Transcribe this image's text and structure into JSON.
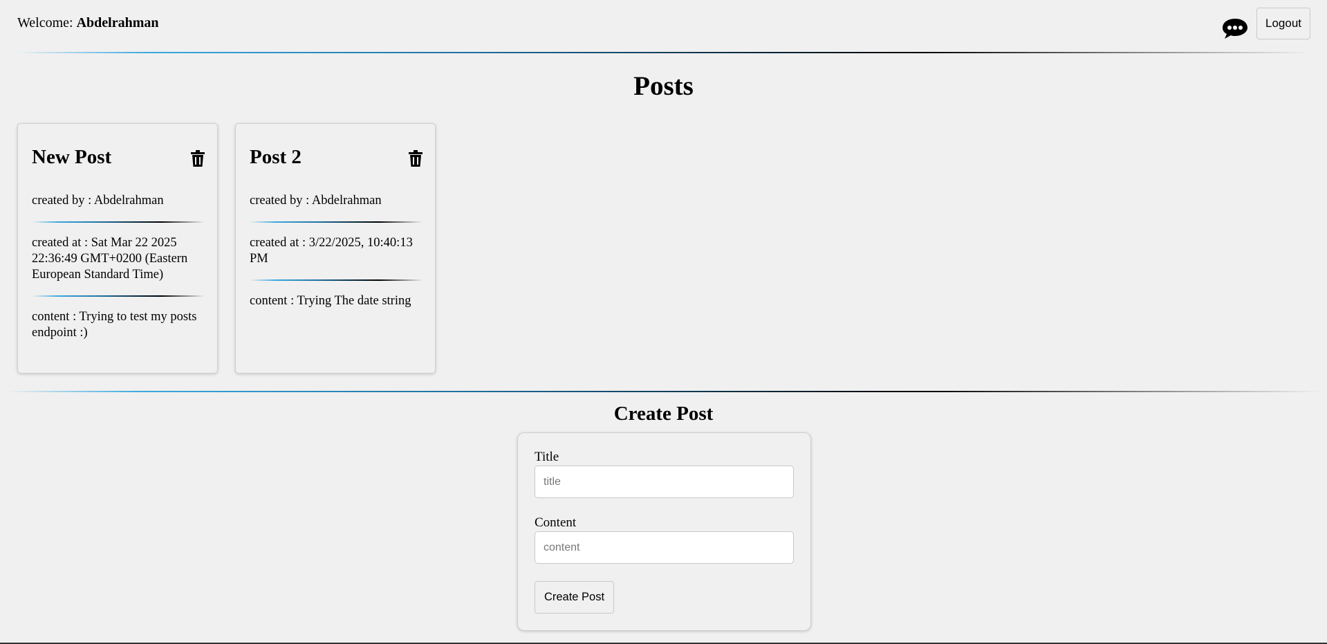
{
  "header": {
    "welcome_label": "Welcome: ",
    "username": "Abdelrahman",
    "chat_icon": "chat-bubble-icon",
    "logout_label": "Logout"
  },
  "page_title": "Posts",
  "posts": [
    {
      "title": "New Post",
      "created_by": "created by : Abdelrahman",
      "created_at": "created at : Sat Mar 22 2025 22:36:49 GMT+0200 (Eastern European Standard Time)",
      "content": "content : Trying to test my posts endpoint :)",
      "delete_icon": "trash-icon"
    },
    {
      "title": "Post 2",
      "created_by": "created by : Abdelrahman",
      "created_at": "created at : 3/22/2025, 10:40:13 PM",
      "content": "content : Trying The date string",
      "delete_icon": "trash-icon"
    }
  ],
  "create_form": {
    "heading": "Create Post",
    "title_label": "Title",
    "title_placeholder": "title",
    "title_value": "",
    "content_label": "Content",
    "content_placeholder": "content",
    "content_value": "",
    "submit_label": "Create Post"
  },
  "colors": {
    "background": "#f0f0f0",
    "separator_accent": "#3aa9e0"
  }
}
